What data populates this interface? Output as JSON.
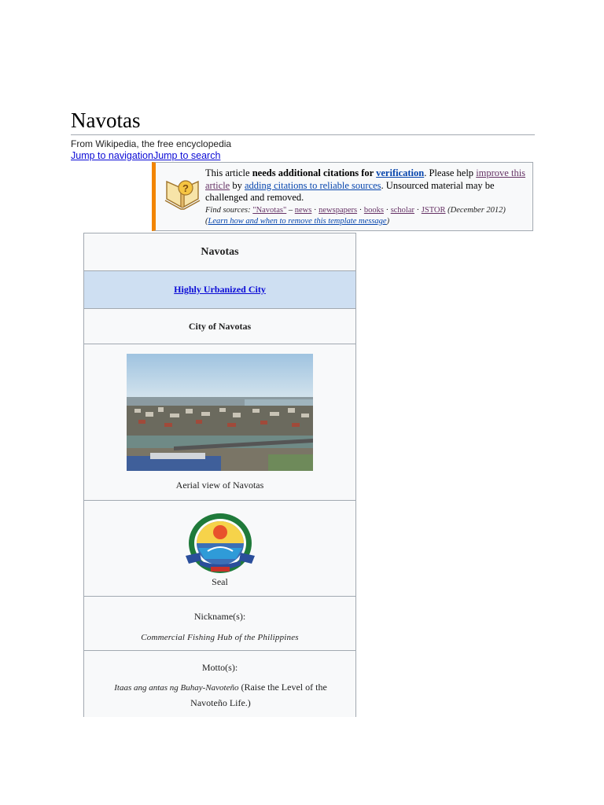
{
  "page": {
    "title": "Navotas",
    "tagline": "From Wikipedia, the free encyclopedia",
    "jump_navigation": "Jump to navigation",
    "jump_search": "Jump to search"
  },
  "notice": {
    "text_1": "This article ",
    "bold": "needs additional citations for ",
    "link_verification": "verification",
    "text_2": ". Please help ",
    "link_improve": "improve this article",
    "text_3": " by ",
    "link_adding": "adding citations to reliable sources",
    "text_4": ". Unsourced material may be challenged and removed.",
    "find_sources": "Find sources:",
    "src_query": "\"Navotas\"",
    "dash": " – ",
    "src_news": "news",
    "src_newspapers": "newspapers",
    "src_books": "books",
    "src_scholar": "scholar",
    "src_jstor": "JSTOR",
    "date": "(December 2012)",
    "learn_open": "(",
    "learn_link": "Learn how and when to remove this template message",
    "learn_close": ")",
    "sep": " · ",
    "border_color": "#f28500"
  },
  "infobox": {
    "name": "Navotas",
    "type": "Highly Urbanized City",
    "official_name": "City of Navotas",
    "photo_caption": "Aerial view of Navotas",
    "seal_caption": "Seal",
    "nickname_label": "Nickname(s):",
    "nickname_value": "Commercial Fishing Hub of the Philippines",
    "motto_label": "Motto(s):",
    "motto_native": "Itaas ang antas ng Buhay-Navoteño",
    "motto_translation": " (Raise the Level of the Navoteño Life.)",
    "type_bg": "#cedff2"
  }
}
